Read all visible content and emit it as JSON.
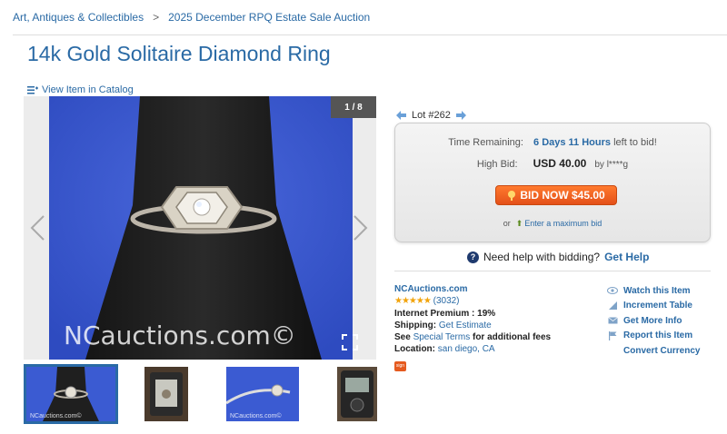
{
  "breadcrumb": {
    "category": "Art, Antiques & Collectibles",
    "separator": ">",
    "auction": "2025 December RPQ Estate Sale Auction"
  },
  "item": {
    "title": "14k Gold Solitaire Diamond Ring",
    "catalog_link": "View Item in Catalog",
    "image_counter": "1 / 8",
    "watermark": "NCauctions.com©",
    "thumb_watermark": "NCauctions.com©"
  },
  "lot": {
    "label": "Lot #262"
  },
  "bidding": {
    "time_label": "Time Remaining:",
    "time_value": "6 Days 11 Hours",
    "time_suffix": "left to bid!",
    "high_label": "High Bid:",
    "high_amount": "USD 40.00",
    "high_by": "by l****g",
    "bid_button": "BID NOW $45.00",
    "or": "or",
    "max_bid": "Enter a maximum bid"
  },
  "help": {
    "text": "Need help with bidding?",
    "link": "Get Help"
  },
  "seller": {
    "name": "NCAuctions.com",
    "stars": "★★★★★",
    "rating_count": "(3032)",
    "premium_label": "Internet Premium :",
    "premium_value": "19%",
    "shipping_label": "Shipping:",
    "shipping_value": "Get Estimate",
    "terms_prefix": "See",
    "terms_link": "Special Terms",
    "terms_suffix": "for additional fees",
    "location_label": "Location:",
    "location_value": "san diego, CA",
    "badge_text": "sign"
  },
  "actions": {
    "watch": "Watch this Item",
    "increment": "Increment Table",
    "info": "Get More Info",
    "report": "Report this Item",
    "convert": "Convert Currency"
  },
  "colors": {
    "link": "#2a6aa5",
    "bid_button": "#ee5d20",
    "photo_bg": "#3b5bd2",
    "stars": "#f2a40c"
  }
}
